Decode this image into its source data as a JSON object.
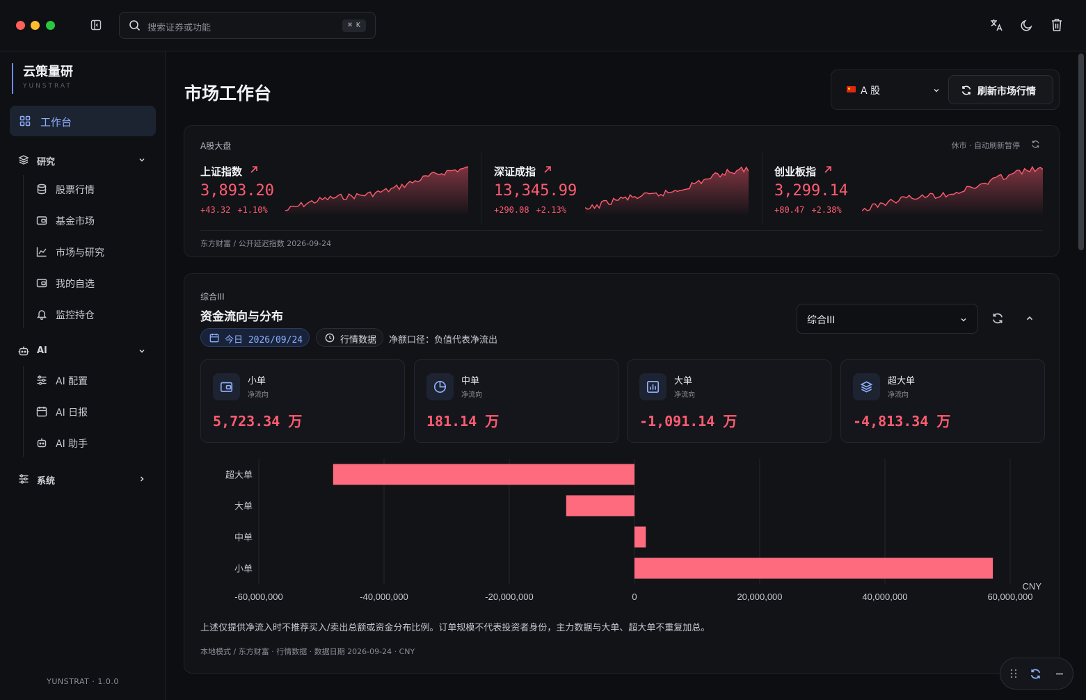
{
  "titlebar": {
    "search_placeholder": "搜索证券或功能",
    "search_shortcut": "⌘ K"
  },
  "sidebar": {
    "brand_title": "云策量研",
    "brand_subtitle": "YUNSTRAT",
    "active_item": "工作台",
    "groups": [
      {
        "label": "研究",
        "items": [
          "股票行情",
          "基金市场",
          "市场与研究",
          "我的自选",
          "监控持仓"
        ]
      },
      {
        "label": "AI",
        "items": [
          "AI 配置",
          "AI 日报",
          "AI 助手"
        ]
      },
      {
        "label": "系统",
        "items": []
      }
    ],
    "version": "YUNSTRAT · 1.0.0"
  },
  "page": {
    "title": "市场工作台",
    "market_select": "A 股",
    "refresh_label": "刷新市场行情"
  },
  "index_card": {
    "label": "A股大盘",
    "status": "休市 · 自动刷新暂停",
    "footer": "东方财富 / 公开延迟指数  2026-09-24",
    "indices": [
      {
        "name": "上证指数",
        "value": "3,893.20",
        "change": "+43.32",
        "pct": "+1.10%"
      },
      {
        "name": "深证成指",
        "value": "13,345.99",
        "change": "+290.08",
        "pct": "+2.13%"
      },
      {
        "name": "创业板指",
        "value": "3,299.14",
        "change": "+80.47",
        "pct": "+2.38%"
      }
    ]
  },
  "flow_card": {
    "category": "综合III",
    "title": "资金流向与分布",
    "date_chip": "今日 2026/09/24",
    "source_chip": "行情数据",
    "note": "净额口径：负值代表净流出",
    "select_value": "综合III",
    "stats": [
      {
        "name": "小单",
        "sub": "净流向",
        "value": "5,723.34 万",
        "icon": "wallet-icon"
      },
      {
        "name": "中单",
        "sub": "净流向",
        "value": "181.14 万",
        "icon": "pie-icon"
      },
      {
        "name": "大单",
        "sub": "净流向",
        "value": "-1,091.14 万",
        "icon": "bar-chart-icon"
      },
      {
        "name": "超大单",
        "sub": "净流向",
        "value": "-4,813.34 万",
        "icon": "layers-icon"
      }
    ],
    "disclaimer": "上述仅提供净流入时不推荐买入/卖出总额或资金分布比例。订单规模不代表投资者身份，主力数据与大单、超大单不重复加总。",
    "meta": "本地模式 / 东方财富 · 行情数据 · 数据日期 2026-09-24 · CNY"
  },
  "chart_data": {
    "type": "bar",
    "orientation": "horizontal",
    "categories": [
      "超大单",
      "大单",
      "中单",
      "小单"
    ],
    "values": [
      -48133400,
      -10911400,
      1811400,
      57233400
    ],
    "xlim": [
      -60000000,
      60000000
    ],
    "xticks": [
      -60000000,
      -40000000,
      -20000000,
      0,
      20000000,
      40000000,
      60000000
    ],
    "xtick_labels": [
      "-60,000,000",
      "-40,000,000",
      "-20,000,000",
      "0",
      "20,000,000",
      "40,000,000",
      "60,000,000"
    ],
    "unit_label": "CNY",
    "bar_color": "#ff6b7e",
    "grid": true
  },
  "colors": {
    "accent": "#8fb0ff",
    "up": "#ff5c71",
    "background": "#0d0e11"
  }
}
